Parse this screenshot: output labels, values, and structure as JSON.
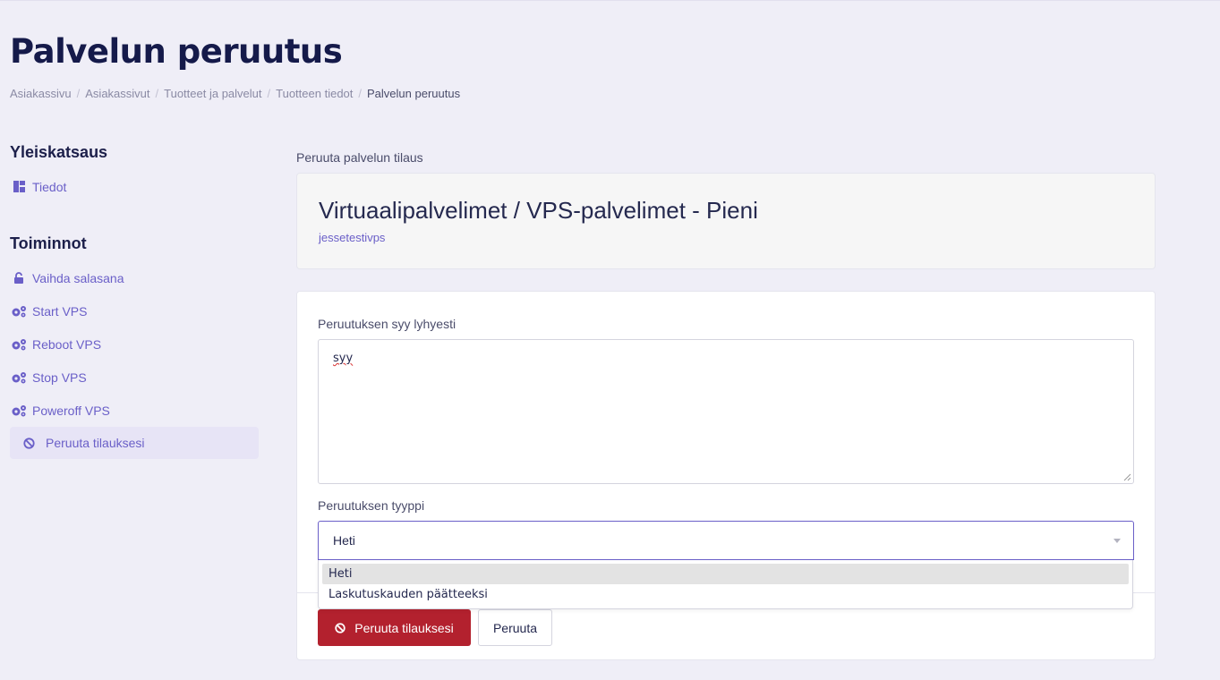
{
  "page": {
    "title": "Palvelun peruutus",
    "breadcrumb": [
      "Asiakassivu",
      "Asiakassivut",
      "Tuotteet ja palvelut",
      "Tuotteen tiedot",
      "Palvelun peruutus"
    ]
  },
  "sidebar": {
    "overview_heading": "Yleiskatsaus",
    "overview_items": [
      {
        "label": "Tiedot",
        "icon": "dashboard-icon"
      }
    ],
    "actions_heading": "Toiminnot",
    "action_items": [
      {
        "label": "Vaihda salasana",
        "icon": "unlock-icon"
      },
      {
        "label": "Start VPS",
        "icon": "cogs-icon"
      },
      {
        "label": "Reboot VPS",
        "icon": "cogs-icon"
      },
      {
        "label": "Stop VPS",
        "icon": "cogs-icon"
      },
      {
        "label": "Poweroff VPS",
        "icon": "cogs-icon"
      },
      {
        "label": "Peruuta tilauksesi",
        "icon": "ban-icon",
        "active": true
      }
    ]
  },
  "main": {
    "section_label": "Peruuta palvelun tilaus",
    "product_title": "Virtuaalipalvelimet / VPS-palvelimet - Pieni",
    "product_hostname": "jessetestivps",
    "reason_label": "Peruutuksen syy lyhyesti",
    "reason_value": "syy",
    "type_label": "Peruutuksen tyyppi",
    "type_selected": "Heti",
    "type_options": [
      "Heti",
      "Laskutuskauden päätteeksi"
    ],
    "submit_label": "Peruuta tilauksesi",
    "cancel_label": "Peruuta"
  },
  "colors": {
    "accent": "#6a5fc8",
    "danger": "#b3212e",
    "background": "#efeef7",
    "heading": "#151a4a"
  }
}
